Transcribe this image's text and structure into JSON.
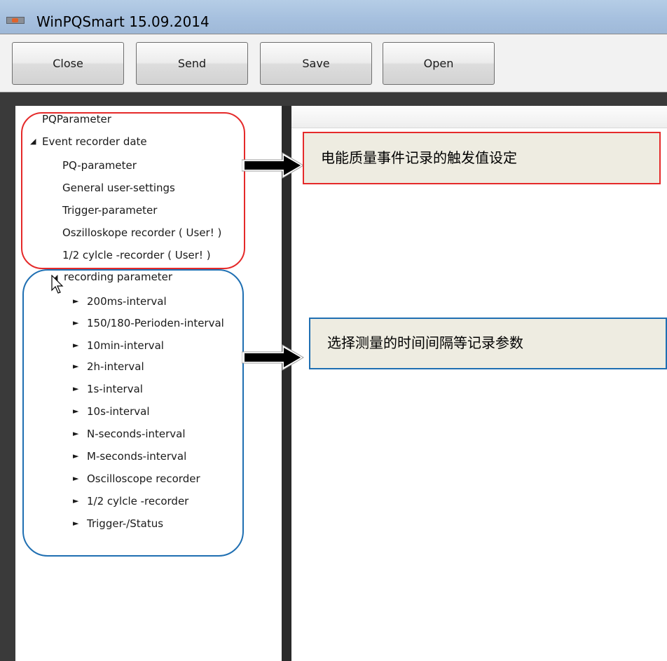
{
  "window": {
    "title": "WinPQSmart 15.09.2014"
  },
  "toolbar": {
    "close_label": "Close",
    "send_label": "Send",
    "save_label": "Save",
    "open_label": "Open"
  },
  "tree": {
    "root": "PQParameter",
    "event_recorder": {
      "label": "Event recorder date",
      "expander": "◢",
      "children": [
        "PQ-parameter",
        "General user-settings",
        "Trigger-parameter",
        "Oszilloskope recorder ( User! )",
        "1/2 cylcle -recorder ( User! )"
      ]
    },
    "recording": {
      "label": "recording parameter",
      "expander": "◢",
      "child_expander": "►",
      "children": [
        "200ms-interval",
        "150/180-Perioden-interval",
        "10min-interval",
        "2h-interval",
        "1s-interval",
        "10s-interval",
        "N-seconds-interval",
        "M-seconds-interval",
        "Oscilloscope recorder",
        "1/2 cylcle -recorder",
        "Trigger-/Status"
      ]
    }
  },
  "callouts": {
    "event_trigger": "电能质量事件记录的触发值设定",
    "recording_params": "选择测量的时间间隔等记录参数"
  },
  "colors": {
    "annotation_red": "#e52a2a",
    "annotation_blue": "#1f6fb2",
    "callout_fill": "#eeece1"
  }
}
